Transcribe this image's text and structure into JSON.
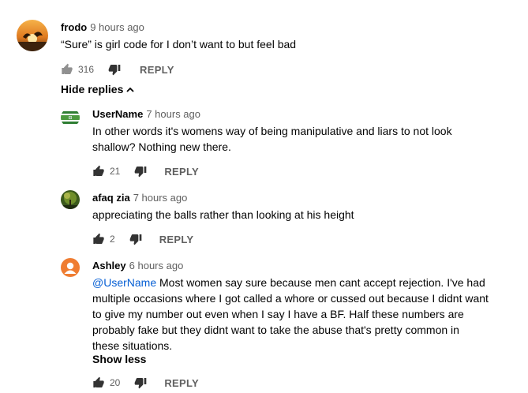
{
  "comments": [
    {
      "author": "frodo",
      "time": "9 hours ago",
      "text": "“Sure” is girl code for I don’t want to but feel bad",
      "likes": "316",
      "reply": "REPLY"
    }
  ],
  "replies_toggle": "Hide replies",
  "replies": [
    {
      "author": "UserName",
      "time": "7 hours ago",
      "text_lines": [
        "In other words it's womens way of being manipulative and liars to not look",
        "shallow? Nothing new there."
      ],
      "likes": "21",
      "reply": "REPLY"
    },
    {
      "author": "afaq zia",
      "time": "7 hours ago",
      "text_lines": [
        "appreciating the balls rather than looking at his height"
      ],
      "likes": "2",
      "reply": "REPLY"
    },
    {
      "author": "Ashley",
      "time": "6 hours ago",
      "mention": "@UserName",
      "text_lines": [
        " Most women say sure because men cant accept rejection. I've had",
        "multiple occasions where I got called a whore or cussed out because I didnt want",
        "to give my number out even when I say I have a BF. Half these numbers are",
        "probably fake but they didnt want to take the abuse that's pretty common in",
        "these situations."
      ],
      "show_less": "Show less",
      "likes": "20",
      "reply": "REPLY"
    }
  ],
  "colors": {
    "link": "#065fd4",
    "meta": "#606060",
    "ashley_avatar": "#ef7d32"
  }
}
